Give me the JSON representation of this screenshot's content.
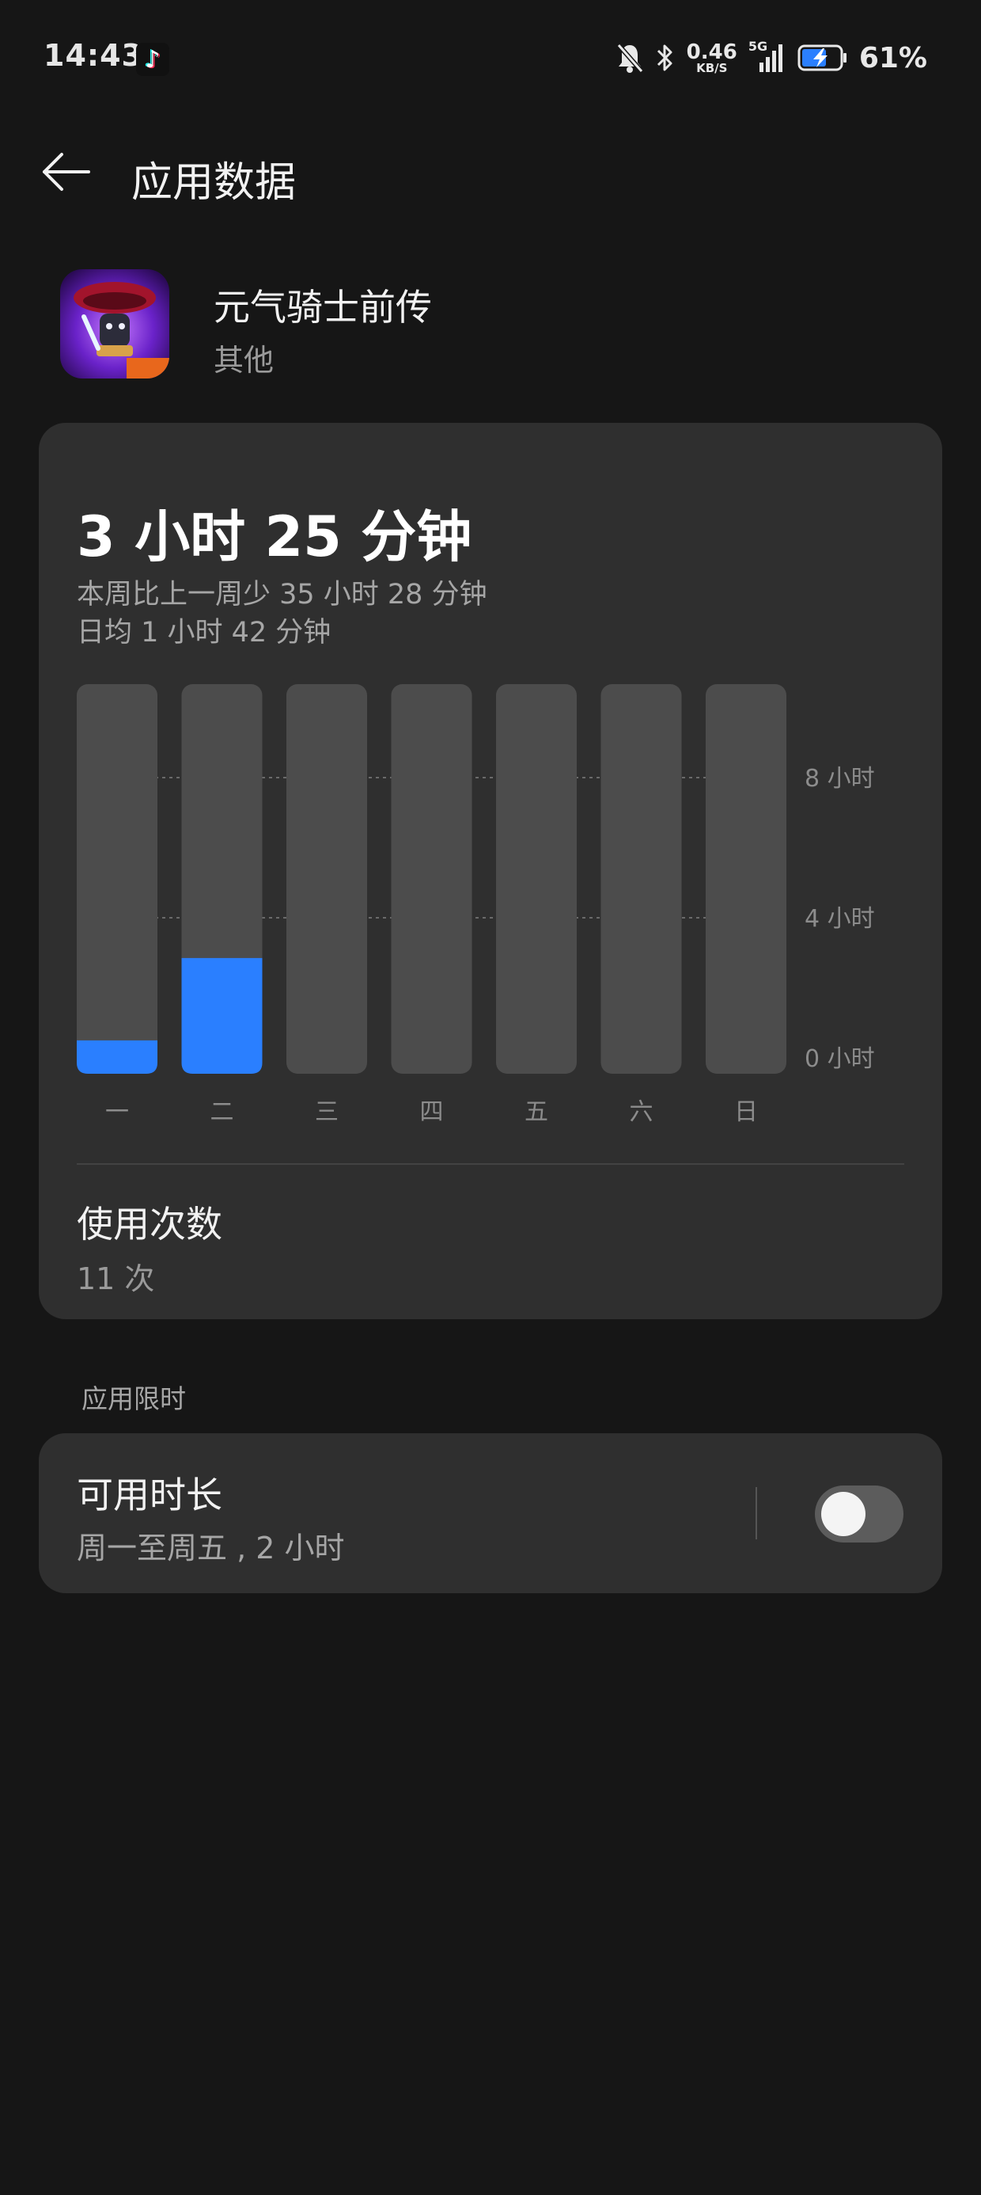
{
  "status_bar": {
    "time": "14:43",
    "net_speed_value": "0.46",
    "net_speed_unit": "KB/S",
    "network_type": "5G",
    "battery_percent": "61%",
    "icons": [
      "tiktok-icon",
      "mute-bell-icon",
      "bluetooth-icon",
      "signal-icon",
      "battery-charging-icon"
    ]
  },
  "header": {
    "back_icon": "back-arrow-icon",
    "title": "应用数据"
  },
  "app": {
    "name": "元气骑士前传",
    "category": "其他",
    "icon": "game-app-icon"
  },
  "usage": {
    "total": "3 小时 25 分钟",
    "compare": "本周比上一周少 35 小时 28 分钟",
    "average": "日均 1 小时 42 分钟",
    "count_label": "使用次数",
    "count_value": "11 次"
  },
  "chart_data": {
    "type": "bar",
    "categories": [
      "一",
      "二",
      "三",
      "四",
      "五",
      "六",
      "日"
    ],
    "values": [
      0.5,
      2.85,
      0,
      0,
      0,
      0,
      0
    ],
    "y_unit": "小时",
    "y_ticks": [
      "8 小时",
      "4 小时",
      "0 小时"
    ],
    "ylim": [
      0,
      10.5
    ],
    "grid": true,
    "bar_color": "#2a7fff",
    "track_color": "#4c4c4c"
  },
  "limit": {
    "section_label": "应用限时",
    "title": "可用时长",
    "desc": "周一至周五 , 2 小时",
    "toggle_on": false
  },
  "colors": {
    "background": "#161616",
    "card": "#2f2f2f",
    "accent": "#2a7fff"
  }
}
